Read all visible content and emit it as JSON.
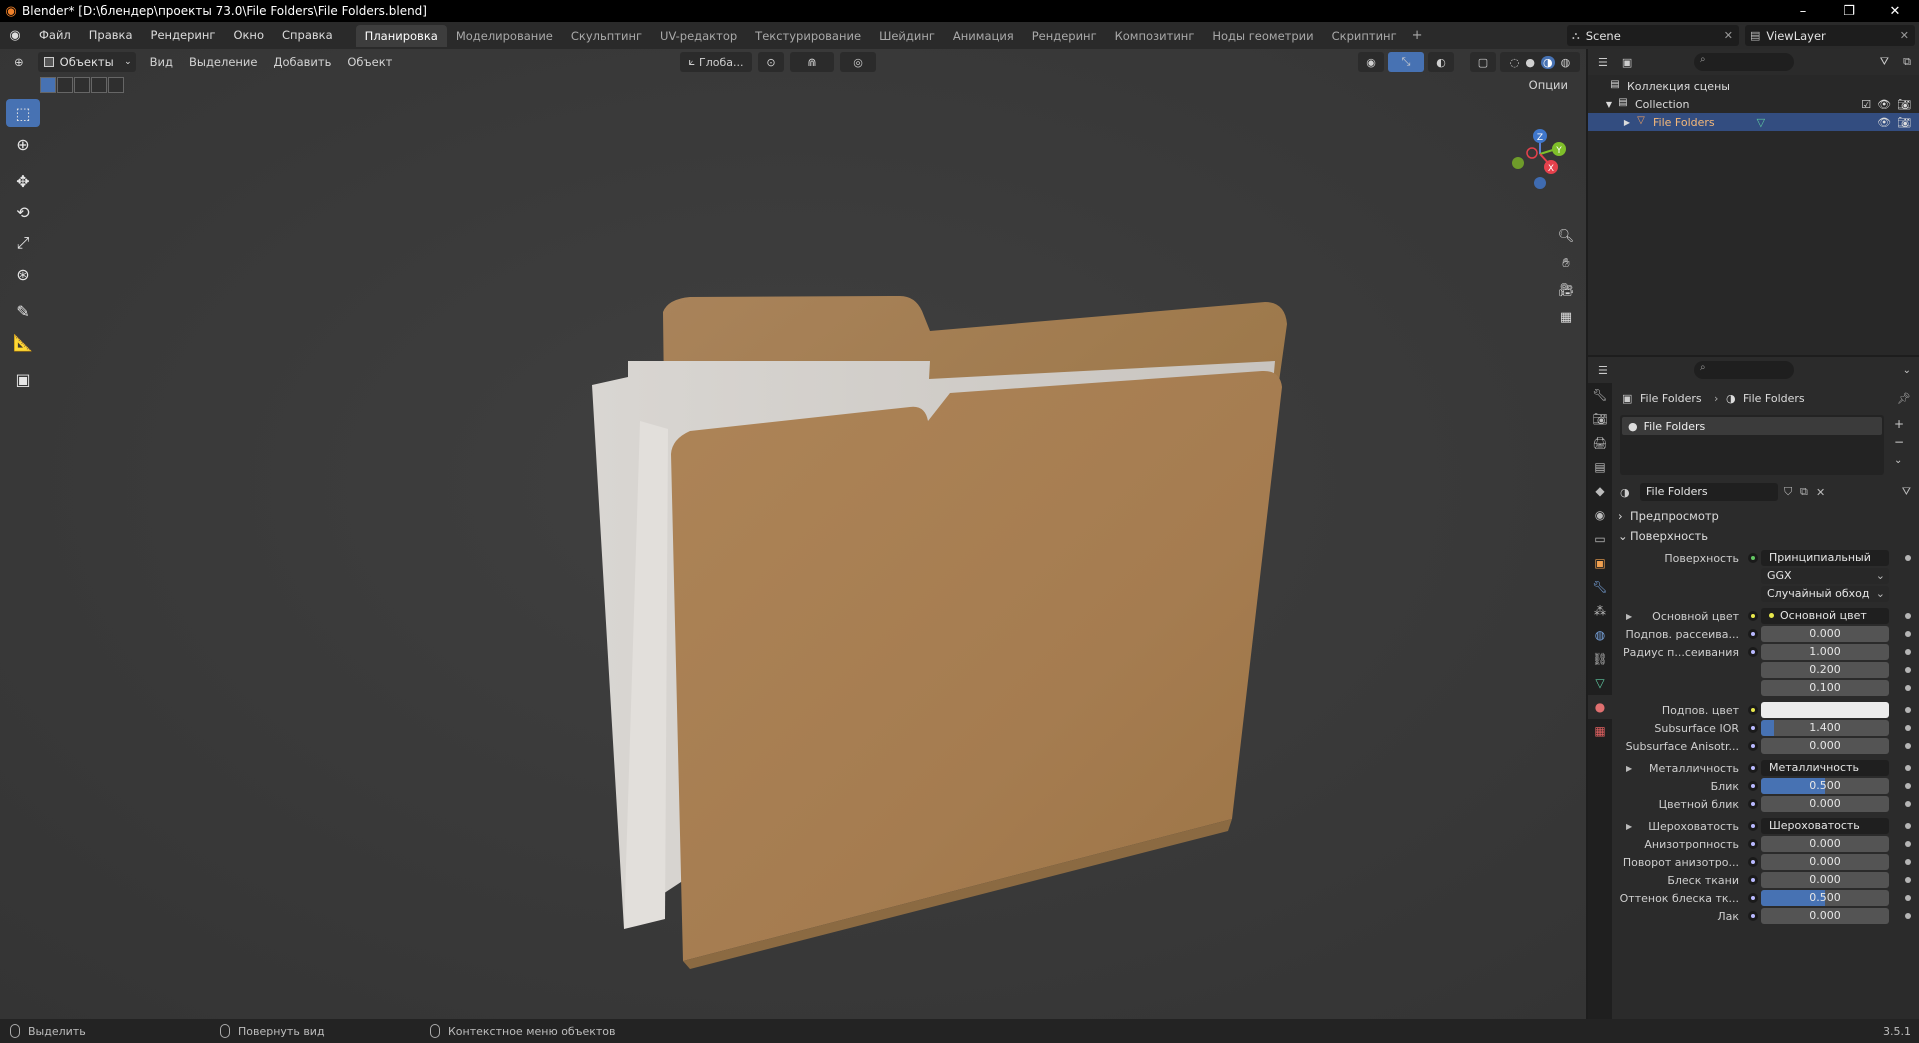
{
  "window": {
    "title": "Blender* [D:\\блендер\\проекты 73.0\\File Folders\\File Folders.blend]",
    "controls": [
      "–",
      "❐",
      "✕"
    ]
  },
  "menu": [
    "Файл",
    "Правка",
    "Рендеринг",
    "Окно",
    "Справка"
  ],
  "workspaces": [
    {
      "label": "Планировка",
      "active": true
    },
    {
      "label": "Моделирование"
    },
    {
      "label": "Скульптинг"
    },
    {
      "label": "UV-редактор"
    },
    {
      "label": "Текстурирование"
    },
    {
      "label": "Шейдинг"
    },
    {
      "label": "Анимация"
    },
    {
      "label": "Рендеринг"
    },
    {
      "label": "Композитинг"
    },
    {
      "label": "Ноды геометрии"
    },
    {
      "label": "Скриптинг"
    }
  ],
  "scene": {
    "name": "Scene",
    "view_layer": "ViewLayer"
  },
  "viewport": {
    "mode": "Объекты",
    "menus": [
      "Вид",
      "Выделение",
      "Добавить",
      "Объект"
    ],
    "transform_orientation": "Глоба...",
    "options": "Опции",
    "gizmo_axes": {
      "z": "Z",
      "y": "Y",
      "x": "X"
    }
  },
  "outliner": {
    "scene_collection": "Коллекция сцены",
    "collection": "Collection",
    "object": "File Folders"
  },
  "properties": {
    "breadcrumb_object": "File Folders",
    "breadcrumb_material": "File Folders",
    "slot_name": "File Folders",
    "material_name": "File Folders",
    "preview_label": "Предпросмотр",
    "surface_section": "Поверхность",
    "rows": [
      {
        "label": "Поверхность",
        "value": "Принципиальный BSDF",
        "kind": "dark",
        "dot": "green"
      },
      {
        "label": "",
        "value": "GGX",
        "kind": "select"
      },
      {
        "label": "",
        "value": "Случайный обход",
        "kind": "select"
      },
      {
        "label": "Основной цвет",
        "value": "Основной цвет",
        "kind": "dark",
        "dot": "yellow",
        "expand": true
      },
      {
        "label": "Подпов. рассеива...",
        "value": "0.000",
        "kind": "num",
        "dot": "gray",
        "fill": 0
      },
      {
        "label": "Радиус п...сеивания",
        "value": "1.000",
        "kind": "num",
        "dot": "blue",
        "fill": 0
      },
      {
        "label": "",
        "value": "0.200",
        "kind": "num",
        "fill": 0
      },
      {
        "label": "",
        "value": "0.100",
        "kind": "num",
        "fill": 0
      },
      {
        "label": "Подпов. цвет",
        "value": "",
        "kind": "white",
        "dot": "yellow"
      },
      {
        "label": "Subsurface IOR",
        "value": "1.400",
        "kind": "num",
        "dot": "gray",
        "fill": 0.1
      },
      {
        "label": "Subsurface Anisotr...",
        "value": "0.000",
        "kind": "num",
        "dot": "gray",
        "fill": 0
      },
      {
        "label": "Металличность",
        "value": "Металличность",
        "kind": "dark",
        "dot": "gray",
        "expand": true
      },
      {
        "label": "Блик",
        "value": "0.500",
        "kind": "num",
        "dot": "gray",
        "fill": 0.5
      },
      {
        "label": "Цветной блик",
        "value": "0.000",
        "kind": "num",
        "dot": "gray",
        "fill": 0
      },
      {
        "label": "Шероховатость",
        "value": "Шероховатость",
        "kind": "dark",
        "dot": "gray",
        "expand": true
      },
      {
        "label": "Анизотропность",
        "value": "0.000",
        "kind": "num",
        "dot": "gray",
        "fill": 0
      },
      {
        "label": "Поворот анизотро...",
        "value": "0.000",
        "kind": "num",
        "dot": "gray",
        "fill": 0
      },
      {
        "label": "Блеск ткани",
        "value": "0.000",
        "kind": "num",
        "dot": "gray",
        "fill": 0
      },
      {
        "label": "Оттенок блеска тк...",
        "value": "0.500",
        "kind": "num",
        "dot": "gray",
        "fill": 0.5
      },
      {
        "label": "Лак",
        "value": "0.000",
        "kind": "num",
        "dot": "gray",
        "fill": 0
      }
    ]
  },
  "status": {
    "select": "Выделить",
    "rotate": "Повернуть вид",
    "context_menu": "Контекстное меню объектов",
    "version": "3.5.1"
  },
  "colors": {
    "accent": "#4772b3",
    "viewport_bg": "#3a3a3a",
    "folder": "#a77c53",
    "paper": "#d6d3cf"
  },
  "icons": {
    "tools": [
      "select-box-icon",
      "cursor-icon",
      "move-icon",
      "rotate-icon",
      "scale-icon",
      "transform-icon",
      "annotate-icon",
      "measure-icon",
      "add-cube-icon"
    ],
    "props_tabs": [
      "tool-icon",
      "render-icon",
      "output-icon",
      "view-layer-icon",
      "scene-icon",
      "world-icon",
      "collection-icon",
      "object-icon",
      "modifier-icon",
      "particles-icon",
      "physics-icon",
      "constraints-icon",
      "data-icon",
      "material-icon",
      "texture-icon"
    ]
  }
}
